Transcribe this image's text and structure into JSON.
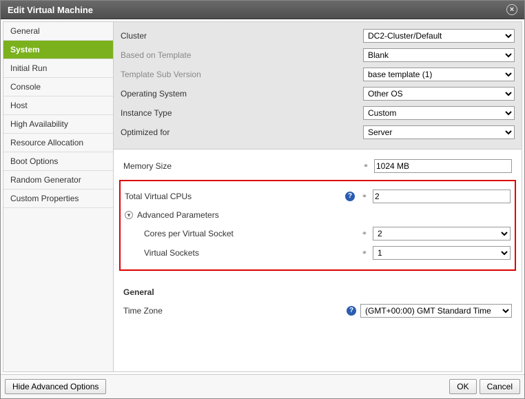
{
  "dialog": {
    "title": "Edit Virtual Machine"
  },
  "sidebar": {
    "items": [
      {
        "label": "General"
      },
      {
        "label": "System"
      },
      {
        "label": "Initial Run"
      },
      {
        "label": "Console"
      },
      {
        "label": "Host"
      },
      {
        "label": "High Availability"
      },
      {
        "label": "Resource Allocation"
      },
      {
        "label": "Boot Options"
      },
      {
        "label": "Random Generator"
      },
      {
        "label": "Custom Properties"
      }
    ],
    "selected_index": 1
  },
  "top_form": {
    "cluster": {
      "label": "Cluster",
      "value": "DC2-Cluster/Default"
    },
    "template": {
      "label": "Based on Template",
      "value": "Blank"
    },
    "template_sub": {
      "label": "Template Sub Version",
      "value": "base template (1)"
    },
    "os": {
      "label": "Operating System",
      "value": "Other OS"
    },
    "instance": {
      "label": "Instance Type",
      "value": "Custom"
    },
    "optimized": {
      "label": "Optimized for",
      "value": "Server"
    }
  },
  "system": {
    "memory": {
      "label": "Memory Size",
      "value": "1024 MB"
    },
    "vcpus": {
      "label": "Total Virtual CPUs",
      "value": "2"
    },
    "advanced_title": "Advanced Parameters",
    "cores": {
      "label": "Cores per Virtual Socket",
      "value": "2"
    },
    "sockets": {
      "label": "Virtual Sockets",
      "value": "1"
    }
  },
  "general": {
    "title": "General",
    "timezone": {
      "label": "Time Zone",
      "value": "(GMT+00:00) GMT Standard Time"
    }
  },
  "footer": {
    "hide_advanced": "Hide Advanced Options",
    "ok": "OK",
    "cancel": "Cancel"
  }
}
